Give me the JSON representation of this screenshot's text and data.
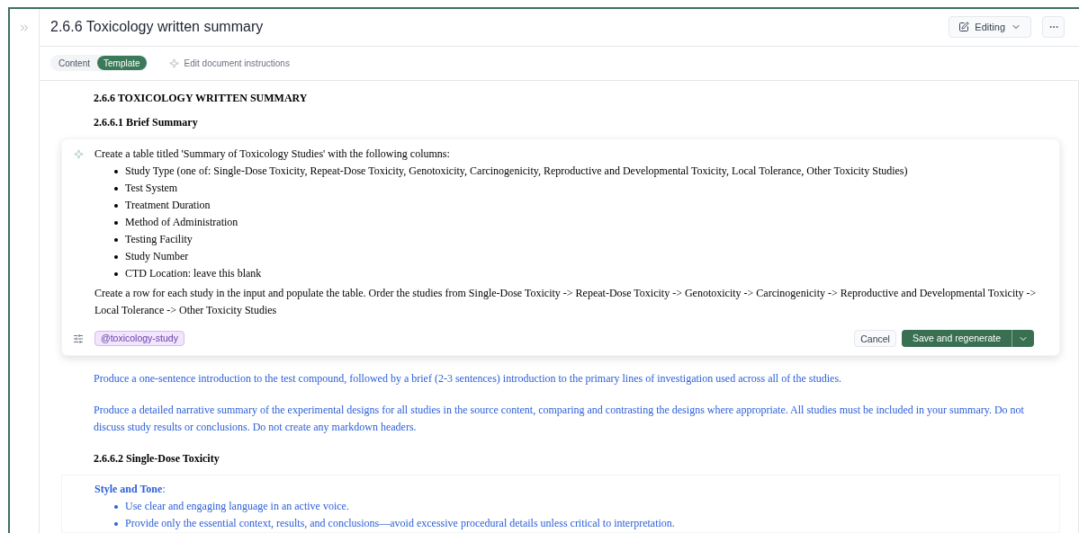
{
  "title": "2.6.6 Toxicology written summary",
  "mode_button": {
    "label": "Editing"
  },
  "view_tabs": [
    {
      "label": "Content",
      "selected": false
    },
    {
      "label": "Template",
      "selected": true
    }
  ],
  "edit_instructions": "Edit document instructions",
  "document": {
    "heading": "2.6.6 TOXICOLOGY WRITTEN SUMMARY",
    "subheading": "2.6.6.1 Brief Summary",
    "prompt_editor": {
      "intro": "Create a table titled 'Summary of Toxicology Studies' with the following columns:",
      "bullets": [
        "Study Type (one of: Single-Dose Toxicity, Repeat-Dose Toxicity, Genotoxicity, Carcinogenicity, Reproductive and Developmental Toxicity, Local Tolerance, Other Toxicity Studies)",
        "Test System",
        "Treatment Duration",
        "Method of Administration",
        "Testing Facility",
        "Study Number",
        "CTD Location: leave this blank"
      ],
      "closing": "Create a row for each study in the input and populate the table. Order the studies from Single-Dose Toxicity -> Repeat-Dose Toxicity -> Genotoxicity -> Carcinogenicity -> Reproductive and Developmental Toxicity -> Local Tolerance -> Other Toxicity Studies",
      "tag": "@toxicology-study",
      "cancel": "Cancel",
      "save": "Save and regenerate"
    },
    "instructions": [
      "Produce a one-sentence introduction to the test compound, followed by a brief (2-3 sentences) introduction to the primary lines of investigation used across all of the studies.",
      "Produce a detailed narrative summary of the experimental designs for all studies in the source content, comparing and contrasting the designs where appropriate. All studies must be included in your summary. Do not discuss study results or conclusions. Do not create any markdown headers."
    ],
    "section_heading": "2.6.6.2 Single-Dose Toxicity",
    "style_block": {
      "title": "**Style and Tone**:",
      "bullets": [
        "Use clear and engaging language in an active voice.",
        "Provide only the essential context, results, and conclusions—avoid excessive procedural details unless critical to interpretation."
      ]
    }
  }
}
